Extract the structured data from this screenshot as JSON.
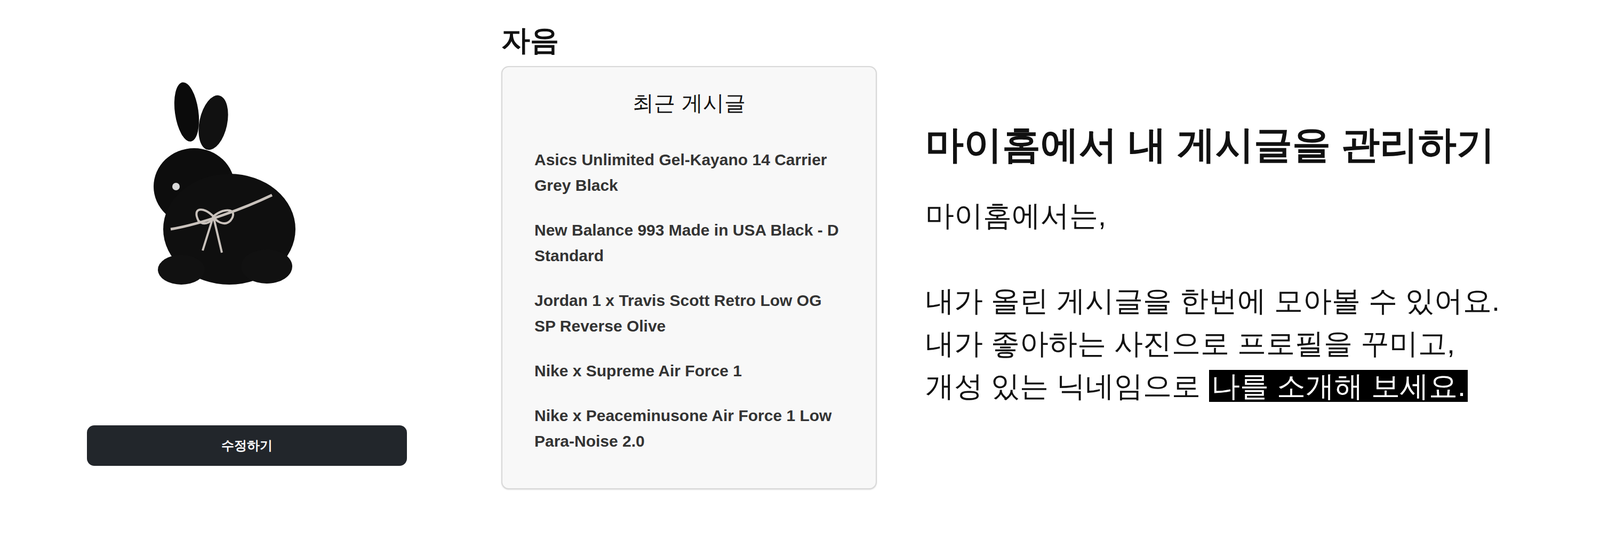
{
  "profile": {
    "edit_button": "수정하기"
  },
  "nickname": "자음",
  "recent_posts": {
    "title": "최근 게시글",
    "items": [
      "Asics Unlimited Gel-Kayano 14 Carrier Grey Black",
      "New Balance 993 Made in USA Black - D Standard",
      "Jordan 1 x Travis Scott Retro Low OG SP Reverse Olive",
      "Nike x Supreme Air Force 1",
      "Nike x Peaceminusone Air Force 1 Low Para-Noise 2.0"
    ]
  },
  "intro": {
    "heading": "마이홈에서 내 게시글을 관리하기",
    "opening": "마이홈에서는,",
    "lines": [
      {
        "text": "내가 올린 게시글을 한번에 모아볼 수 있어요.",
        "highlight": ""
      },
      {
        "text": "내가 좋아하는 사진으로 프로필을 꾸미고,",
        "highlight": ""
      },
      {
        "text": "개성 있는 닉네임으로",
        "highlight": "나를 소개해 보세요."
      }
    ]
  }
}
